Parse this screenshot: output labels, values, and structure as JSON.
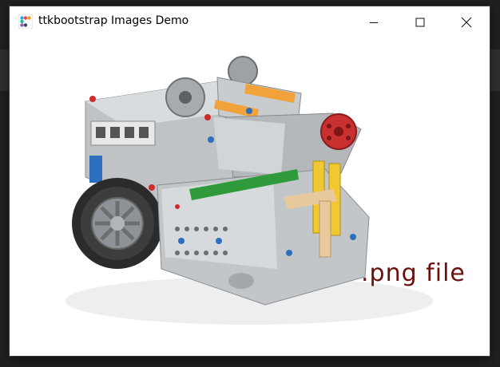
{
  "window": {
    "title": "ttkbootstrap Images Demo",
    "buttons": {
      "minimize": "minimize-icon",
      "maximize": "maximize-icon",
      "close": "close-icon"
    }
  },
  "content": {
    "image_label": ".png file",
    "image_subject": "robot-image",
    "label_color": "#6b0f0f"
  },
  "colors": {
    "window_bg": "#ffffff",
    "backdrop": "#202020"
  }
}
